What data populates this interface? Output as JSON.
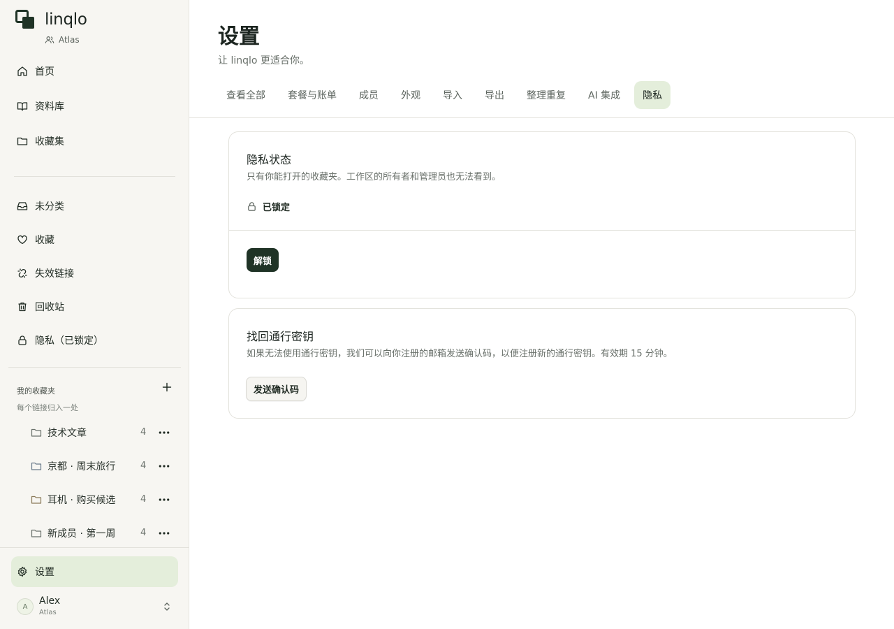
{
  "app": {
    "name": "linqlo",
    "workspace": "Atlas"
  },
  "sidebar": {
    "primary": [
      {
        "icon": "home-icon",
        "label": "首页"
      },
      {
        "icon": "book-icon",
        "label": "资料库"
      },
      {
        "icon": "folder-icon",
        "label": "收藏集"
      }
    ],
    "secondary": [
      {
        "icon": "inbox-icon",
        "label": "未分类"
      },
      {
        "icon": "heart-icon",
        "label": "收藏"
      },
      {
        "icon": "broken-link-icon",
        "label": "失效链接"
      },
      {
        "icon": "trash-icon",
        "label": "回收站"
      },
      {
        "icon": "lock-icon",
        "label": "隐私（已锁定）"
      }
    ],
    "folders_section": {
      "title": "我的收藏夹",
      "subtitle": "每个链接归入一处",
      "items": [
        {
          "label": "技术文章",
          "count": "4"
        },
        {
          "label": "京都 · 周末旅行",
          "count": "4"
        },
        {
          "label": "耳机 · 购买候选",
          "count": "4"
        },
        {
          "label": "新成员 · 第一周",
          "count": "4"
        }
      ]
    },
    "settings_label": "设置",
    "user": {
      "initial": "A",
      "name": "Alex",
      "workspace": "Atlas"
    }
  },
  "main": {
    "title": "设置",
    "subtitle": "让 linqlo 更适合你。",
    "tabs": [
      {
        "label": "查看全部"
      },
      {
        "label": "套餐与账单"
      },
      {
        "label": "成员"
      },
      {
        "label": "外观"
      },
      {
        "label": "导入"
      },
      {
        "label": "导出"
      },
      {
        "label": "整理重复"
      },
      {
        "label": "AI 集成"
      },
      {
        "label": "隐私",
        "active": true
      }
    ],
    "privacy_card": {
      "title": "隐私状态",
      "description": "只有你能打开的收藏夹。工作区的所有者和管理员也无法看到。",
      "status": "已锁定",
      "unlock_label": "解锁"
    },
    "recovery_card": {
      "title": "找回通行密钥",
      "description": "如果无法使用通行密钥，我们可以向你注册的邮箱发送确认码，以便注册新的通行密钥。有效期 15 分钟。",
      "button_label": "发送确认码"
    }
  },
  "colors": {
    "accent_active_bg": "#e4eedb",
    "primary_button": "#1f3326",
    "sidebar_bg": "#f7f6f2"
  }
}
